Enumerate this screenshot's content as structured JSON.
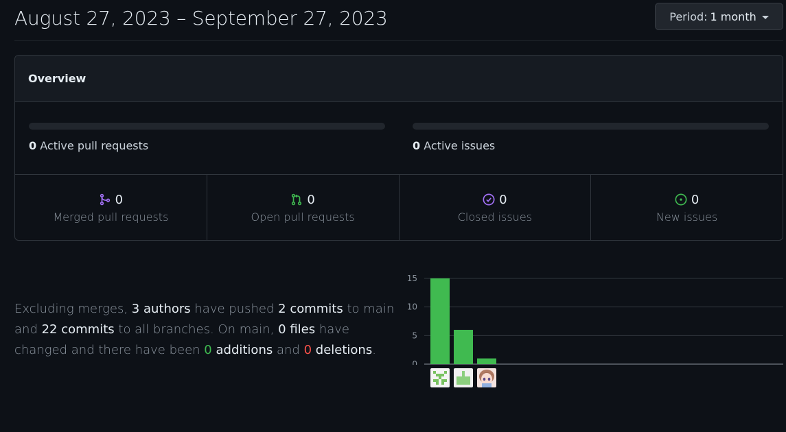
{
  "header": {
    "date_range": "August 27, 2023 – September 27, 2023",
    "period_label": "Period:",
    "period_value": "1 month"
  },
  "overview": {
    "title": "Overview",
    "active_prs": {
      "count": "0",
      "label": "Active pull requests",
      "fraction": 0
    },
    "active_issues": {
      "count": "0",
      "label": "Active issues",
      "fraction": 0
    },
    "stats": [
      {
        "count": "0",
        "label": "Merged pull requests",
        "icon": "git-merge-icon",
        "color": "#a371f7"
      },
      {
        "count": "0",
        "label": "Open pull requests",
        "icon": "git-pull-request-icon",
        "color": "#3fb950"
      },
      {
        "count": "0",
        "label": "Closed issues",
        "icon": "issue-closed-icon",
        "color": "#a371f7"
      },
      {
        "count": "0",
        "label": "New issues",
        "icon": "issue-opened-icon",
        "color": "#3fb950"
      }
    ]
  },
  "summary": {
    "p1": "Excluding merges,",
    "authors": "3 authors",
    "p2": "have pushed",
    "commits_main": "2 commits",
    "p3": "to main and",
    "commits_all": "22 commits",
    "p4": "to all branches. On main,",
    "files": "0 files",
    "p5": "have changed and there have been",
    "additions_num": "0",
    "additions_word": "additions",
    "p6": "and",
    "deletions_num": "0",
    "deletions_word": "deletions",
    "p7": "."
  },
  "chart_data": {
    "type": "bar",
    "categories": [
      "author-1",
      "author-2",
      "author-3"
    ],
    "values": [
      15,
      6,
      1
    ],
    "yticks": [
      0,
      5,
      10,
      15
    ],
    "ylim": [
      0,
      15
    ],
    "bar_color": "#40ba50",
    "grid": true
  },
  "avatars": [
    {
      "name": "avatar-author-1"
    },
    {
      "name": "avatar-author-2"
    },
    {
      "name": "avatar-author-3"
    }
  ]
}
